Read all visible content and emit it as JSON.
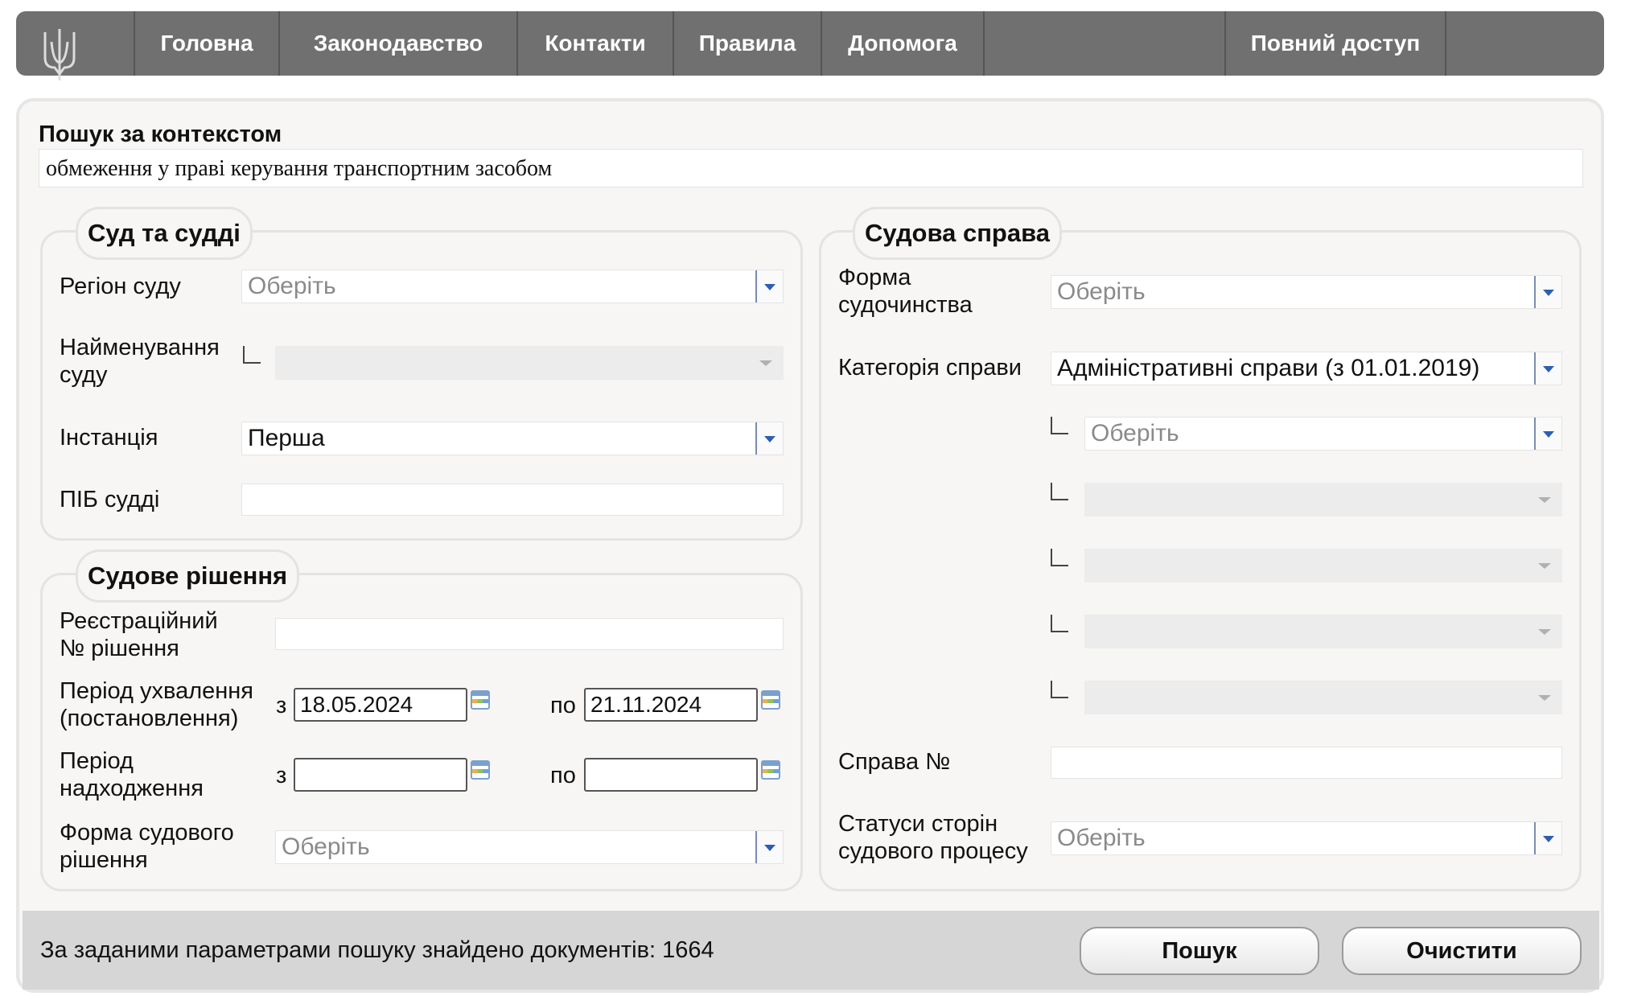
{
  "nav": {
    "items": [
      "Головна",
      "Законодавство",
      "Контакти",
      "Правила",
      "Допомога"
    ],
    "full_access": "Повний доступ"
  },
  "context_search": {
    "label": "Пошук за контекстом",
    "value": "обмеження у праві керування транспортним засобом"
  },
  "court_judges": {
    "legend": "Суд та судді",
    "region_label": "Регіон суду",
    "region_value": "Оберіть",
    "court_name_label": "Найменування суду",
    "instance_label": "Інстанція",
    "instance_value": "Перша",
    "judge_label": "ПІБ судді",
    "judge_value": ""
  },
  "decision": {
    "legend": "Судове рішення",
    "reg_no_label": "Реєстраційний № рішення",
    "reg_no_value": "",
    "adoption_label": "Період ухвалення (постановлення)",
    "from_word": "з",
    "to_word": "по",
    "adoption_from": "18.05.2024",
    "adoption_to": "21.11.2024",
    "receipt_label": "Період надходження",
    "receipt_from": "",
    "receipt_to": "",
    "form_label": "Форма судового рішення",
    "form_value": "Оберіть"
  },
  "case": {
    "legend": "Судова справа",
    "proceeding_form_label": "Форма судочинства",
    "proceeding_form_value": "Оберіть",
    "category_label": "Категорія справи",
    "category_value": "Адміністративні справи (з 01.01.2019)",
    "subcategory_value": "Оберіть",
    "case_no_label": "Справа №",
    "case_no_value": "",
    "party_status_label": "Статуси сторін судового процесу",
    "party_status_value": "Оберіть"
  },
  "footer": {
    "result_text": "За заданими параметрами пошуку знайдено документів: 1664",
    "search_button": "Пошук",
    "clear_button": "Очистити"
  },
  "colors": {
    "nav_bg": "#707070",
    "panel_bg": "#f7f6f4",
    "footer_bg": "#d6d6d6",
    "dropdown_arrow": "#2b5fb3"
  }
}
